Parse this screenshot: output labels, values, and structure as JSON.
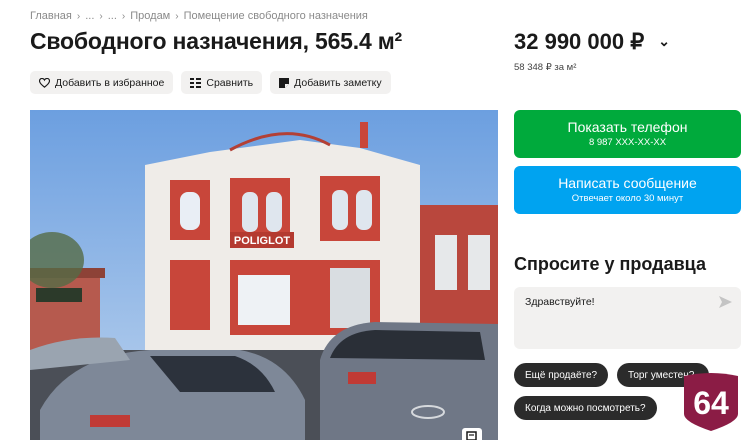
{
  "breadcrumb": {
    "items": [
      "Главная",
      "...",
      "...",
      "Продам",
      "Помещение свободного назначения"
    ]
  },
  "listing": {
    "title": "Свободного назначения, 565.4 м²",
    "price": "32 990 000 ₽",
    "price_per_m": "58 348 ₽ за м²"
  },
  "actions": {
    "favorite": "Добавить в избранное",
    "compare": "Сравнить",
    "note": "Добавить заметку"
  },
  "photo": {
    "sign_text": "POLIGLOT"
  },
  "contact": {
    "phone_label": "Показать телефон",
    "phone_number": "8 987 XXX-XX-XX",
    "message_label": "Написать сообщение",
    "message_sub": "Отвечает около 30 минут"
  },
  "ask": {
    "title": "Спросите у продавца",
    "message_value": "Здравствуйте!",
    "chips": [
      "Ещё продаёте?",
      "Торг уместен?",
      "Когда можно посмотреть?"
    ]
  },
  "badge": {
    "text": "64",
    "color": "#8b1c45"
  },
  "colors": {
    "green": "#00aa3c",
    "blue": "#00a3f0",
    "chip": "#2b2b2b"
  },
  "icons": {
    "favorite": "heart-icon",
    "compare": "compare-icon",
    "note": "note-icon",
    "send": "send-icon",
    "price_toggle": "chevron-down-icon",
    "gallery": "gallery-icon"
  }
}
